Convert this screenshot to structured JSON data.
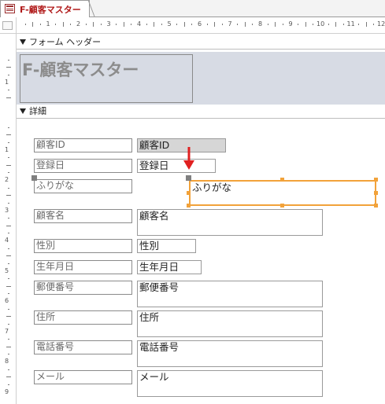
{
  "tab": {
    "title": "F-顧客マスター",
    "accent_color": "#b01919"
  },
  "ruler": {
    "h_labels": [
      "1",
      "2",
      "3",
      "4",
      "5",
      "6",
      "7",
      "8",
      "9",
      "10",
      "11",
      "12"
    ],
    "v_labels_header": [
      "1"
    ],
    "v_labels_detail": [
      "1",
      "2",
      "3",
      "4",
      "5",
      "6",
      "7",
      "8",
      "9"
    ]
  },
  "sections": {
    "header": "フォーム ヘッダー",
    "detail": "詳細"
  },
  "header": {
    "title": "F-顧客マスター"
  },
  "detail": {
    "labels": [
      "顧客ID",
      "登録日",
      "ふりがな",
      "顧客名",
      "性別",
      "生年月日",
      "郵便番号",
      "住所",
      "電話番号",
      "メール"
    ],
    "textboxes": [
      "顧客ID",
      "登録日",
      "ふりがな",
      "顧客名",
      "性別",
      "生年月日",
      "郵便番号",
      "住所",
      "電話番号",
      "メール"
    ]
  },
  "colors": {
    "selection": "#f2a23a",
    "arrow": "#e02020",
    "header_bg": "#d7dbe4"
  }
}
